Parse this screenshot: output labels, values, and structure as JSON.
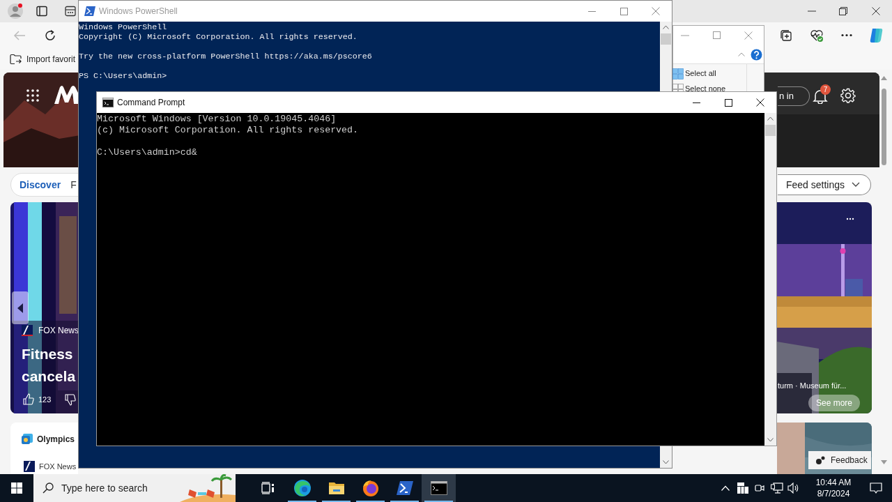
{
  "browser": {
    "favorites_bar": [
      {
        "label": "Import favorit"
      }
    ],
    "msn": {
      "tabs": [
        {
          "label": "Discover",
          "selected": true
        },
        {
          "label": "F",
          "selected": false
        }
      ],
      "sign_in": "n in",
      "notifications_badge": "7",
      "feed_settings": "Feed settings",
      "left_card": {
        "source": "FOX News",
        "title_lines": [
          "Fitness",
          "cancela"
        ],
        "likes": "123"
      },
      "right_card": {
        "caption": "turm · Museum für...",
        "button": "See more"
      },
      "olympics_card": {
        "title": "Olympics",
        "source": "FOX News"
      },
      "feedback": "Feedback"
    }
  },
  "explorer": {
    "ribbon_items": [
      "Select all",
      "Select none"
    ]
  },
  "powershell": {
    "title": "Windows PowerShell",
    "blocks": [
      [
        "Windows PowerShell",
        "Copyright (C) Microsoft Corporation. All rights reserved."
      ],
      [
        "Try the new cross-platform PowerShell https://aka.ms/pscore6"
      ],
      [
        "PS C:\\Users\\admin>"
      ]
    ]
  },
  "cmd": {
    "title": "Command Prompt",
    "blocks": [
      [
        "Microsoft Windows [Version 10.0.19045.4046]",
        "(c) Microsoft Corporation. All rights reserved."
      ],
      [
        "C:\\Users\\admin>cd&"
      ]
    ]
  },
  "taskbar": {
    "search_placeholder": "Type here to search",
    "apps": [
      {
        "kind": "taskview",
        "running": false,
        "selected": false
      },
      {
        "kind": "edge",
        "running": true,
        "selected": false
      },
      {
        "kind": "explorer",
        "running": true,
        "selected": false
      },
      {
        "kind": "firefox",
        "running": true,
        "selected": false
      },
      {
        "kind": "powershell",
        "running": true,
        "selected": false
      },
      {
        "kind": "cmd",
        "running": true,
        "selected": true
      }
    ],
    "time": "10:44 AM",
    "date": "8/7/2024"
  }
}
